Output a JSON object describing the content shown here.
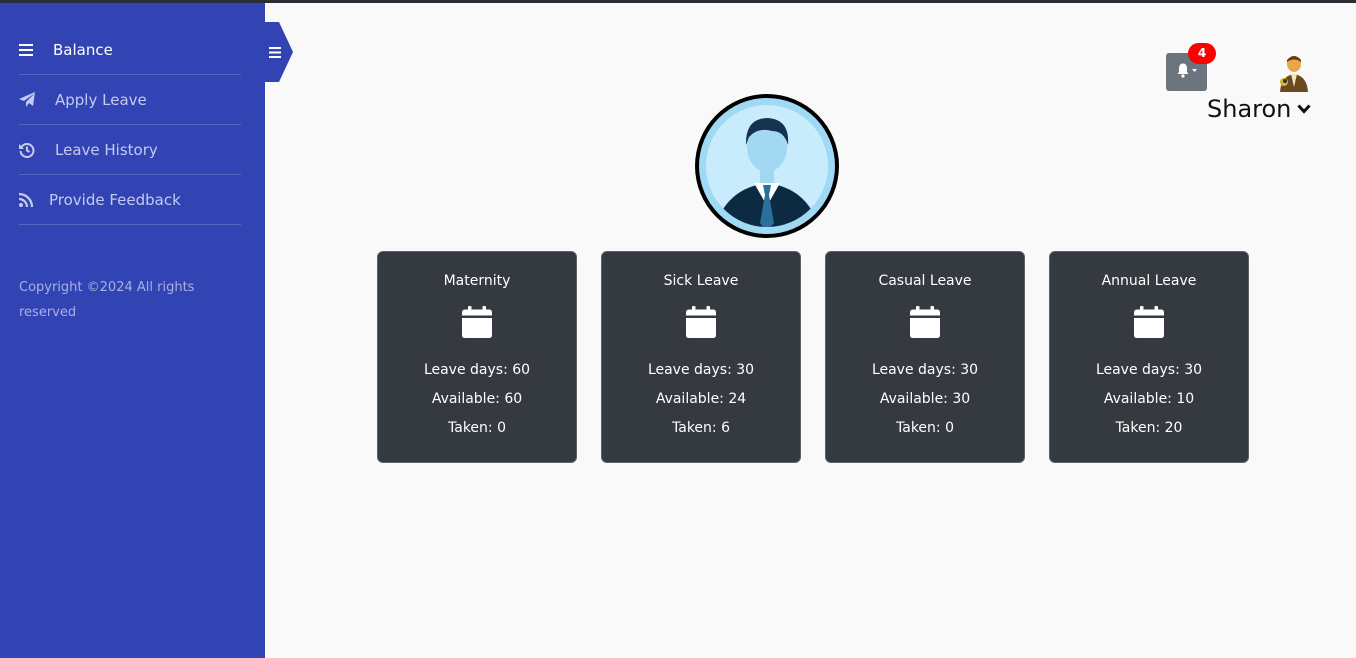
{
  "sidebar": {
    "items": [
      {
        "label": "Balance",
        "icon": "bars-icon"
      },
      {
        "label": "Apply Leave",
        "icon": "paper-plane-icon"
      },
      {
        "label": "Leave History",
        "icon": "history-icon"
      },
      {
        "label": "Provide Feedback",
        "icon": "rss-icon"
      }
    ],
    "copyright": "Copyright ©2024 All rights reserved"
  },
  "header": {
    "notification_count": "4",
    "username": "Sharon"
  },
  "cards": [
    {
      "title": "Maternity",
      "leave_days": "Leave days: 60",
      "available": "Available: 60",
      "taken": "Taken: 0"
    },
    {
      "title": "Sick Leave",
      "leave_days": "Leave days: 30",
      "available": "Available: 24",
      "taken": "Taken: 6"
    },
    {
      "title": "Casual Leave",
      "leave_days": "Leave days: 30",
      "available": "Available: 30",
      "taken": "Taken: 0"
    },
    {
      "title": "Annual Leave",
      "leave_days": "Leave days: 30",
      "available": "Available: 10",
      "taken": "Taken: 20"
    }
  ],
  "colors": {
    "sidebar": "#3243b3",
    "card": "#343a40",
    "badge": "#ff0000",
    "background": "#f9f9f9"
  }
}
